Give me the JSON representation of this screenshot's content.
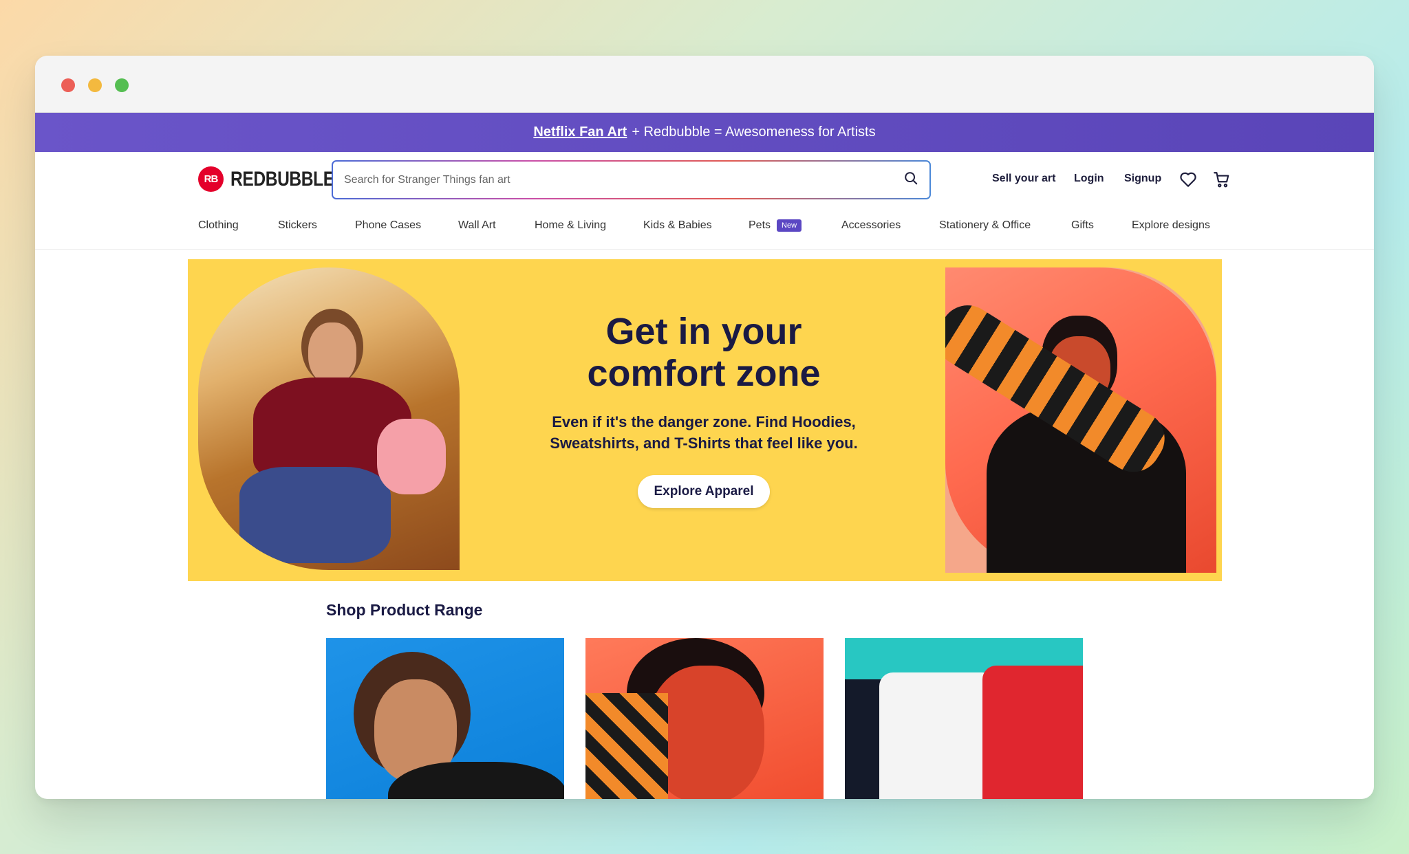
{
  "promo": {
    "link_text": "Netflix Fan Art",
    "rest_text": "+ Redbubble = Awesomeness for Artists"
  },
  "header": {
    "logo_text": "REDBUBBLE",
    "logo_mark": "RB",
    "search_placeholder": "Search for Stranger Things fan art",
    "sell_label": "Sell your art",
    "login_label": "Login",
    "signup_label": "Signup",
    "icons": [
      "search-icon",
      "heart-icon",
      "cart-icon"
    ]
  },
  "nav": {
    "items": [
      {
        "label": "Clothing"
      },
      {
        "label": "Stickers"
      },
      {
        "label": "Phone Cases"
      },
      {
        "label": "Wall Art"
      },
      {
        "label": "Home & Living"
      },
      {
        "label": "Kids & Babies"
      },
      {
        "label": "Pets",
        "badge": "New"
      },
      {
        "label": "Accessories"
      },
      {
        "label": "Stationery & Office"
      },
      {
        "label": "Gifts"
      },
      {
        "label": "Explore designs"
      }
    ]
  },
  "hero": {
    "title_line1": "Get in your",
    "title_line2": "comfort zone",
    "subtitle": "Even if it's the danger zone. Find Hoodies, Sweatshirts, and T-Shirts that feel like you.",
    "button_label": "Explore Apparel"
  },
  "shop": {
    "title": "Shop Product Range"
  },
  "colors": {
    "promo_bg": "#6a55c9",
    "hero_bg": "#fed54f",
    "text_dark": "#1a1a44",
    "brand_red": "#e4002b",
    "badge": "#5b47c3"
  }
}
